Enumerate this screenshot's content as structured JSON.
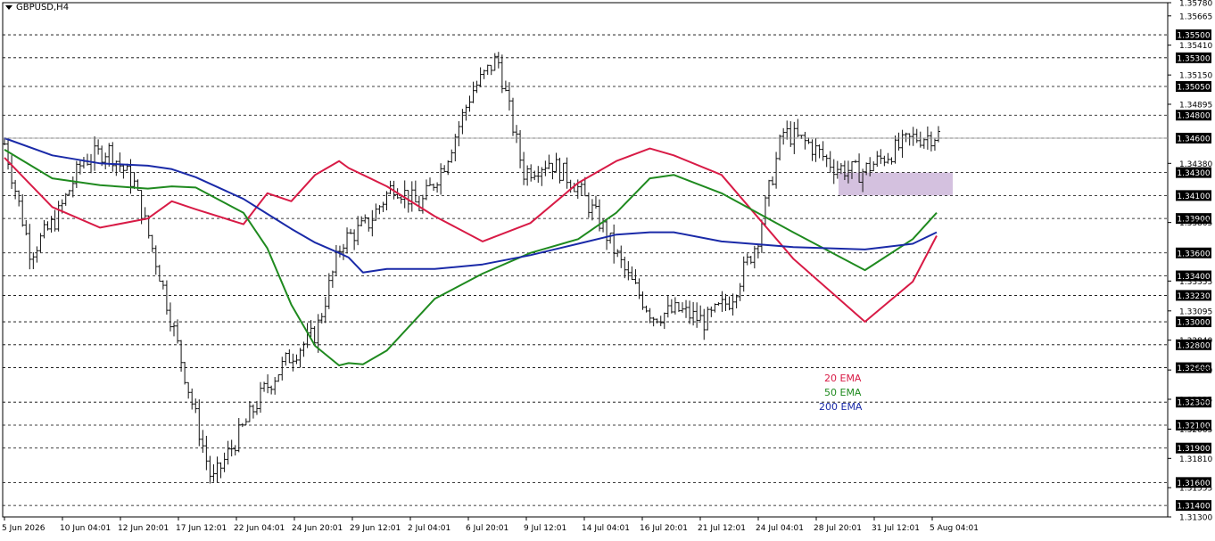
{
  "symbol": {
    "title": "GBPUSD,H4"
  },
  "legend": [
    {
      "label": "20 EMA",
      "color": "#d81b46"
    },
    {
      "label": "50 EMA",
      "color": "#1f8a1f"
    },
    {
      "label": "200 EMA",
      "color": "#1a2aa8"
    }
  ],
  "chart_data": {
    "type": "line",
    "title": "GBPUSD,H4",
    "xlabel": "",
    "ylabel": "",
    "ylim": [
      1.313,
      1.3578
    ],
    "grid": "horizontal dashed at marked levels",
    "x_ticks": [
      "5 Jun 2026",
      "10 Jun 04:01",
      "12 Jun 20:01",
      "17 Jun 12:01",
      "22 Jun 04:01",
      "24 Jun 20:01",
      "29 Jun 12:01",
      "2 Jul 04:01",
      "6 Jul 20:01",
      "9 Jul 12:01",
      "14 Jul 04:01",
      "16 Jul 20:01",
      "21 Jul 12:01",
      "24 Jul 04:01",
      "28 Jul 20:01",
      "31 Jul 12:01",
      "5 Aug 04:01"
    ],
    "y_ticks": [
      "1.35780",
      "1.35665",
      "1.35410",
      "1.35150",
      "1.34895",
      "1.34380",
      "1.33865",
      "1.33355",
      "1.33095",
      "1.32840",
      "1.32580",
      "1.32325",
      "1.32065",
      "1.31810",
      "1.31555",
      "1.31300"
    ],
    "marked_levels": [
      "1.35500",
      "1.35300",
      "1.35050",
      "1.34800",
      "1.34600",
      "1.34300",
      "1.34100",
      "1.33900",
      "1.33600",
      "1.33400",
      "1.33230",
      "1.33000",
      "1.32800",
      "1.32600",
      "1.32300",
      "1.32100",
      "1.31900",
      "1.31600",
      "1.31400"
    ],
    "current_price": "1.34600",
    "highlight_zone": {
      "from": 1.341,
      "to": 1.343
    },
    "series": [
      {
        "name": "20 EMA",
        "color": "#d81b46",
        "x": [
          0,
          10,
          20,
          30,
          35,
          40,
          50,
          55,
          60,
          65,
          70,
          72,
          75,
          80,
          90,
          100,
          110,
          120,
          128,
          135,
          140,
          150,
          165,
          180,
          190,
          195
        ],
        "values": [
          1.3443,
          1.34,
          1.3382,
          1.339,
          1.3405,
          1.3398,
          1.3385,
          1.3412,
          1.3405,
          1.3428,
          1.344,
          1.3434,
          1.3428,
          1.3418,
          1.3392,
          1.337,
          1.3386,
          1.3421,
          1.344,
          1.3451,
          1.3445,
          1.3428,
          1.3355,
          1.33,
          1.3335,
          1.3375
        ]
      },
      {
        "name": "50 EMA",
        "color": "#1f8a1f",
        "x": [
          0,
          10,
          20,
          30,
          35,
          40,
          50,
          55,
          60,
          65,
          70,
          72,
          75,
          80,
          90,
          100,
          110,
          120,
          128,
          135,
          140,
          150,
          165,
          180,
          190,
          195
        ],
        "values": [
          1.345,
          1.3425,
          1.3419,
          1.3416,
          1.3418,
          1.3417,
          1.3395,
          1.3364,
          1.3315,
          1.3279,
          1.3262,
          1.3264,
          1.3263,
          1.3275,
          1.332,
          1.3342,
          1.336,
          1.3372,
          1.3395,
          1.3425,
          1.3428,
          1.3412,
          1.3378,
          1.3345,
          1.3372,
          1.3395
        ]
      },
      {
        "name": "200 EMA",
        "color": "#1a2aa8",
        "x": [
          0,
          10,
          20,
          30,
          35,
          40,
          50,
          55,
          60,
          65,
          70,
          72,
          75,
          80,
          90,
          100,
          110,
          120,
          128,
          135,
          140,
          150,
          165,
          180,
          190,
          195
        ],
        "values": [
          1.346,
          1.3445,
          1.3438,
          1.3436,
          1.3433,
          1.3426,
          1.3407,
          1.3394,
          1.3381,
          1.3369,
          1.336,
          1.3356,
          1.3343,
          1.3346,
          1.3346,
          1.335,
          1.3358,
          1.3368,
          1.3376,
          1.3378,
          1.3378,
          1.337,
          1.3365,
          1.3363,
          1.3368,
          1.3378
        ]
      }
    ],
    "price_path": [
      1.3455,
      1.336,
      1.339,
      1.344,
      1.345,
      1.342,
      1.334,
      1.325,
      1.316,
      1.32,
      1.324,
      1.327,
      1.329,
      1.337,
      1.3385,
      1.342,
      1.34,
      1.344,
      1.35,
      1.353,
      1.343,
      1.344,
      1.342,
      1.3385,
      1.334,
      1.3305,
      1.331,
      1.33,
      1.332,
      1.337,
      1.3465,
      1.3455,
      1.3435,
      1.343,
      1.3445,
      1.346,
      1.3463
    ]
  }
}
